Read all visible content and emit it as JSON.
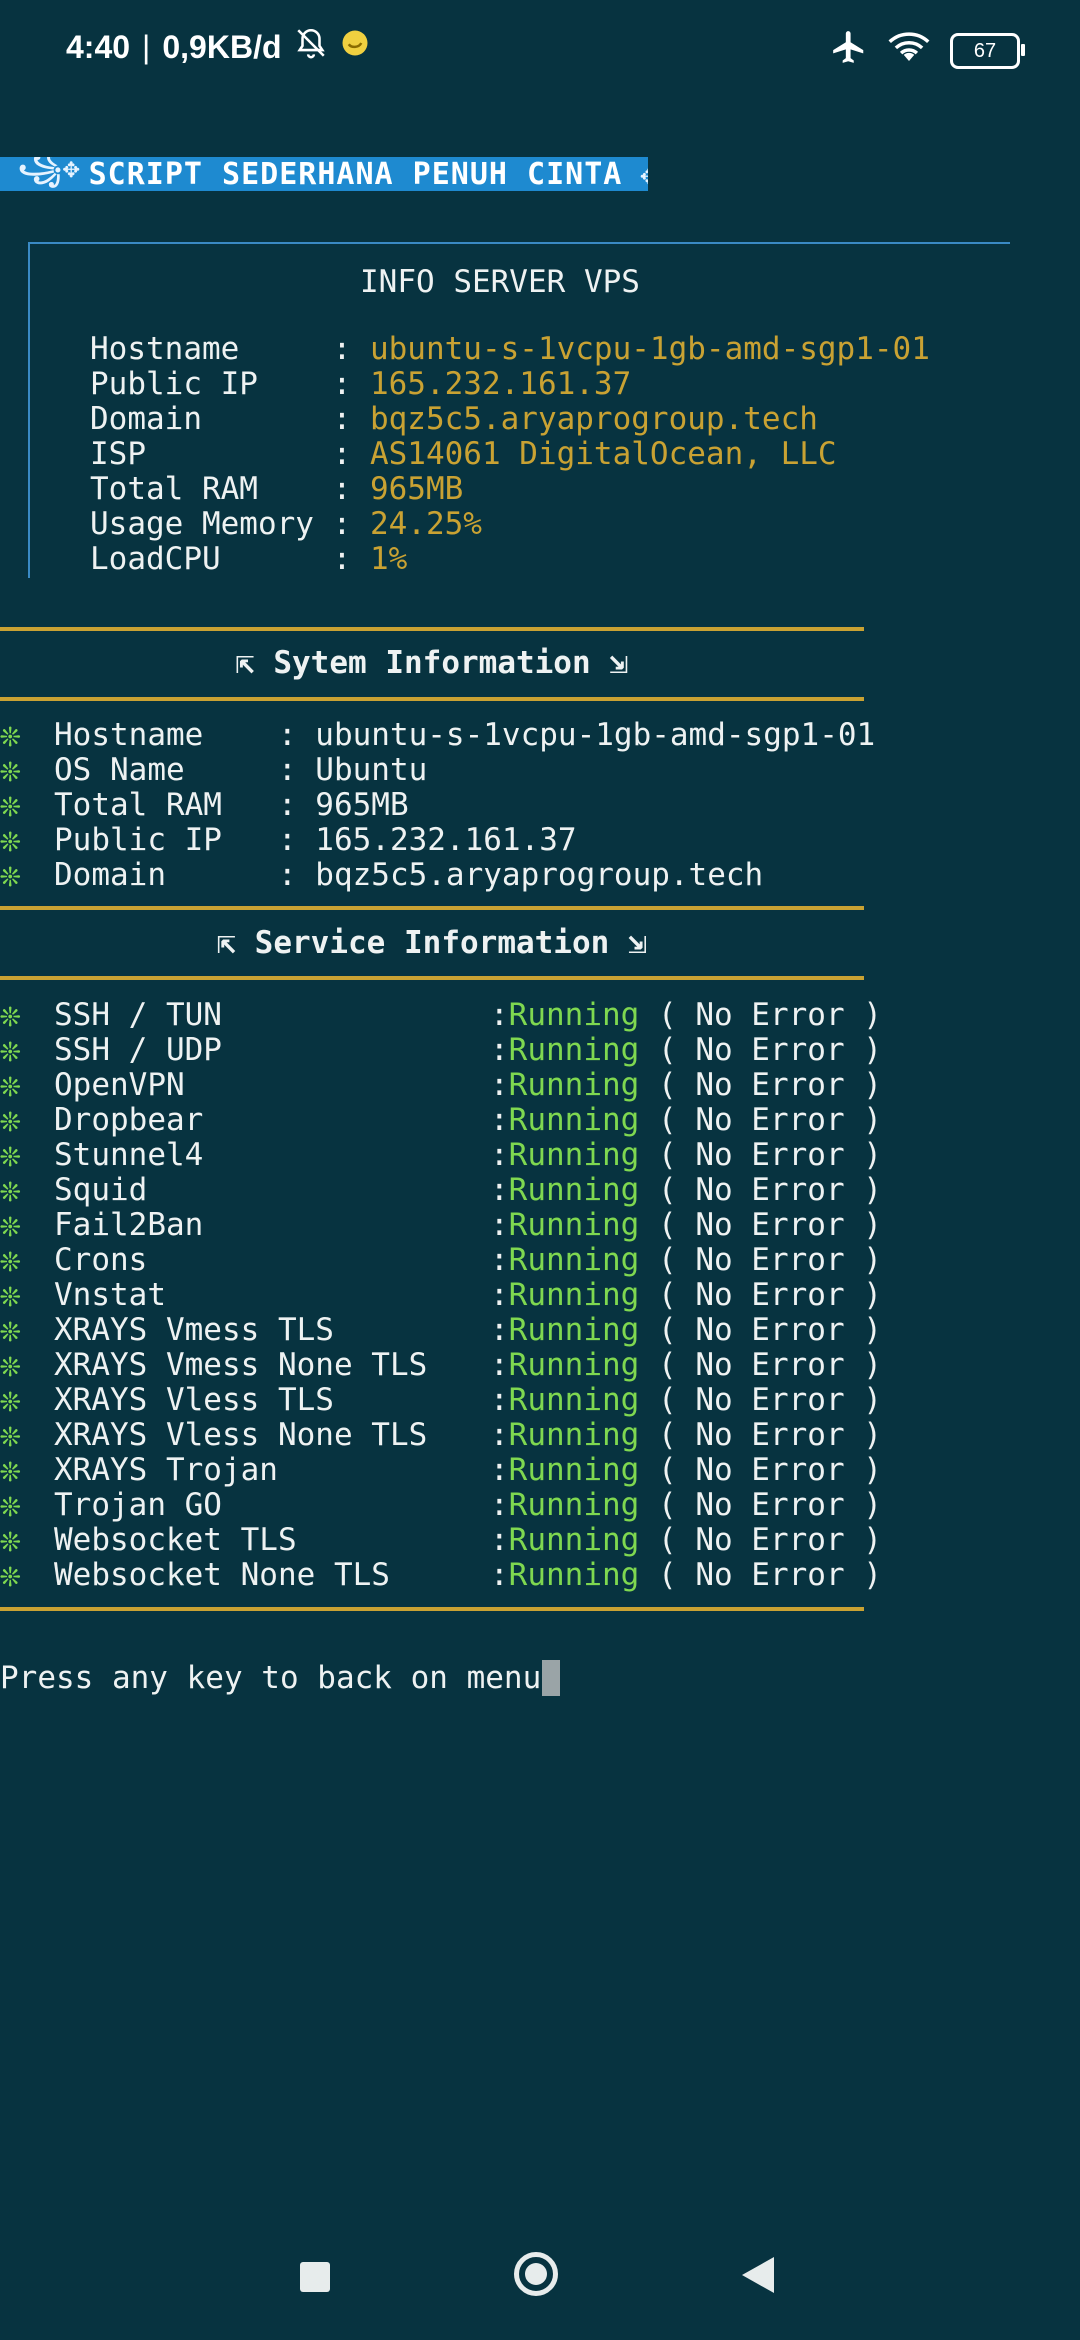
{
  "status_bar": {
    "time": "4:40",
    "separator": "|",
    "speed": "0,9KB/d",
    "battery": "67"
  },
  "banner": {
    "deco_left": "꧁✥",
    "title": "SCRIPT SEDERHANA PENUH CINTA",
    "deco_right": "✥"
  },
  "info_box": {
    "title": "INFO SERVER VPS",
    "rows": [
      {
        "label": "Hostname     : ",
        "value": "ubuntu-s-1vcpu-1gb-amd-sgp1-01"
      },
      {
        "label": "Public IP    : ",
        "value": "165.232.161.37"
      },
      {
        "label": "Domain       : ",
        "value": "bqz5c5.aryaprogroup.tech"
      },
      {
        "label": "ISP          : ",
        "value": "AS14061 DigitalOcean, LLC"
      },
      {
        "label": "Total RAM    : ",
        "value": "965MB"
      },
      {
        "label": "Usage Memory : ",
        "value": "24.25%"
      },
      {
        "label": "LoadCPU      : ",
        "value": "1%"
      }
    ]
  },
  "system_section": {
    "title": "⇱ Sytem Information ⇲",
    "rows": [
      {
        "text": "Hostname    : ubuntu-s-1vcpu-1gb-amd-sgp1-01"
      },
      {
        "text": "OS Name     : Ubuntu"
      },
      {
        "text": "Total RAM   : 965MB"
      },
      {
        "text": "Public IP   : 165.232.161.37"
      },
      {
        "text": "Domain      : bqz5c5.aryaprogroup.tech"
      }
    ]
  },
  "service_section": {
    "title": "⇱ Service Information ⇲",
    "status": "Running",
    "suffix": " ( No Error )",
    "colon": ":",
    "services": [
      {
        "name": "SSH / TUN"
      },
      {
        "name": "SSH / UDP"
      },
      {
        "name": "OpenVPN"
      },
      {
        "name": "Dropbear"
      },
      {
        "name": "Stunnel4"
      },
      {
        "name": "Squid"
      },
      {
        "name": "Fail2Ban"
      },
      {
        "name": "Crons"
      },
      {
        "name": "Vnstat"
      },
      {
        "name": "XRAYS Vmess TLS"
      },
      {
        "name": "XRAYS Vmess None TLS"
      },
      {
        "name": "XRAYS Vless TLS"
      },
      {
        "name": "XRAYS Vless None TLS"
      },
      {
        "name": "XRAYS Trojan"
      },
      {
        "name": "Trojan GO"
      },
      {
        "name": "Websocket TLS"
      },
      {
        "name": "Websocket None TLS"
      }
    ]
  },
  "bullet_icon": "❊",
  "prompt": "Press any key to back on menu",
  "colors": {
    "background": "#073340",
    "accent_gold": "#c9a233",
    "running_green": "#7fd850",
    "banner_blue": "#1e8ad0"
  }
}
